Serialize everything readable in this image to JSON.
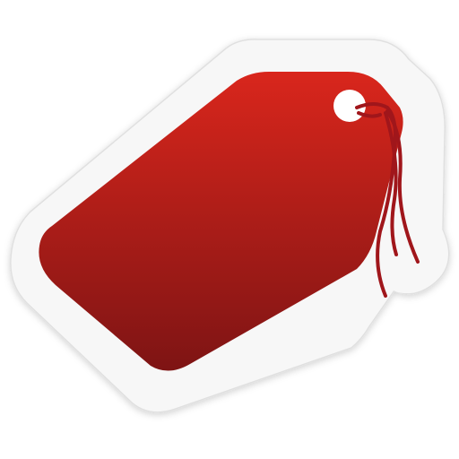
{
  "icon": {
    "name": "price-tag-icon",
    "colors": {
      "tag_top": "#d9261c",
      "tag_bottom": "#7e1414",
      "sticker": "#f7f7f7",
      "sticker_edge": "#e0e0e0",
      "hole": "#ffffff",
      "string": "#a0161b"
    }
  }
}
